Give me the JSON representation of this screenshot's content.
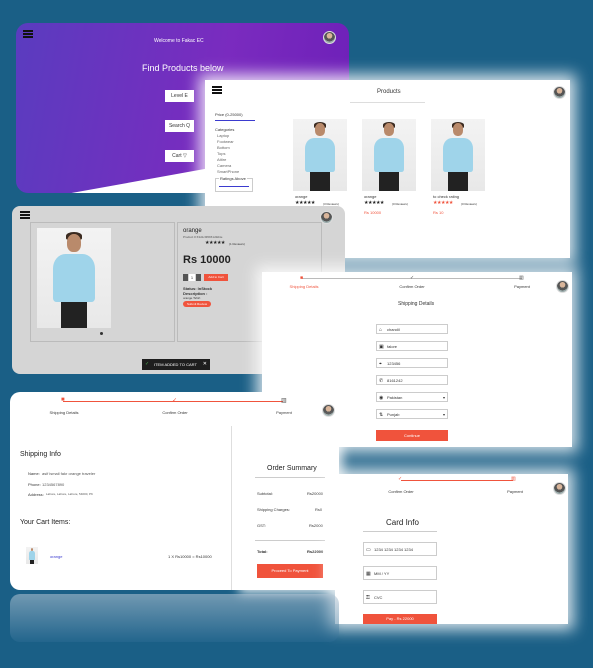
{
  "home": {
    "welcome": "Welcome to Fakac EC",
    "heading": "Find Products below",
    "buttons": [
      "Level E",
      "Search Q",
      "Cart ▽"
    ]
  },
  "products": {
    "title": "Products",
    "filters": {
      "price": "Price (0-25000)",
      "categories_label": "Categories",
      "categories": [
        "Laptop",
        "Footwear",
        "Bottom",
        "Tops",
        "Attire",
        "Camera",
        "SmartPhone"
      ],
      "ratings": "Ratings Above"
    },
    "items": [
      {
        "name": "orange",
        "reviews": "(3 Reviews)",
        "price": "Rs 10000"
      },
      {
        "name": "orange",
        "reviews": "(0 Reviews)",
        "price": "Rs 10000"
      },
      {
        "name": "to check rating",
        "reviews": "(0 Reviews)",
        "price": "Rs 10"
      }
    ]
  },
  "detail": {
    "name": "orange",
    "subtitle": "Product # 63d1c9f6b51d9d4e",
    "stars": "★★★★★",
    "reviews": "(1 Reviews)",
    "price": "Rs 10000",
    "qty": "1",
    "add_btn": "Add to Cart",
    "status_label": "Status: InStock",
    "desc_label": "Description :",
    "desc": "orange Tshirt",
    "review_btn": "Submit Review",
    "toast": "ITEM ADDED TO CART",
    "toast_close": "✕"
  },
  "shipping": {
    "steps": [
      "Shipping Details",
      "Confirm Order",
      "Payment"
    ],
    "title": "Shipping Details",
    "fields": [
      "chandil",
      "falore",
      "123456",
      "8161242",
      "Pakistan",
      "Punjab"
    ],
    "continue": "Continue"
  },
  "confirm": {
    "steps": [
      "Shipping Details",
      "Confirm Order",
      "Payment"
    ],
    "shipping_title": "Shipping Info",
    "name_label": "Name:",
    "name": "asif ismail fakr orange traveler",
    "phone_label": "Phone:",
    "phone": "1234567890",
    "address_label": "Address:",
    "address": "Lahore, Lahore, Lahore, 54000, PK",
    "cart_title": "Your Cart Items:",
    "cart_item": "orange",
    "cart_qty": "1 X Rs10000 = Rs10000",
    "summary_title": "Order Summary",
    "rows": [
      {
        "label": "Subtotal:",
        "value": "Rs20000"
      },
      {
        "label": "Shipping Charges:",
        "value": "Rs0"
      },
      {
        "label": "GST:",
        "value": "Rs2000"
      }
    ],
    "total_label": "Total:",
    "total": "Rs22000",
    "pay_btn": "Proceed To Payment"
  },
  "payment": {
    "steps": [
      "Confirm Order",
      "Payment"
    ],
    "title": "Card Info",
    "fields": [
      "1234 1234 1234 1234",
      "MM / YY",
      "CVC"
    ],
    "pay_btn": "Pay - Rs 22000"
  }
}
